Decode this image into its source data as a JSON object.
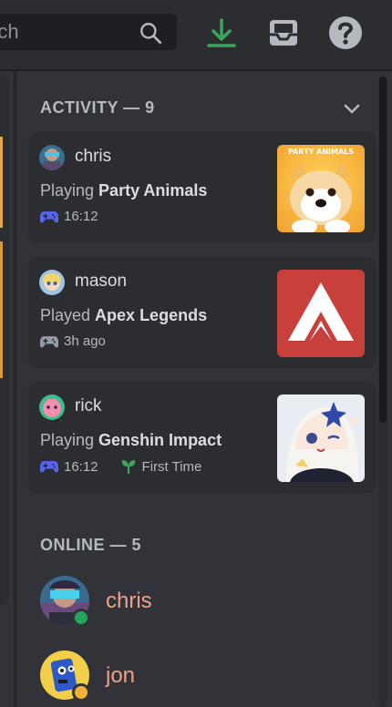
{
  "search": {
    "placeholder": "rch"
  },
  "toolbar": {
    "download_icon": "download-icon",
    "inbox_icon": "inbox-icon",
    "help_icon": "help-icon"
  },
  "colors": {
    "background": "#313338",
    "card": "#2b2d31",
    "download_green": "#3ba55c",
    "online_green": "#23a55a",
    "member_name": "#f0a18a",
    "gamepad_blue": "#5865f2"
  },
  "activity": {
    "header": "ACTIVITY — 9",
    "cards": [
      {
        "username": "chris",
        "verb": "Playing ",
        "game": "Party Animals",
        "time": "16:12",
        "thumb_text": "PARTY ANIMALS"
      },
      {
        "username": "mason",
        "verb": "Played ",
        "game": "Apex Legends",
        "time": "3h ago"
      },
      {
        "username": "rick",
        "verb": "Playing ",
        "game": "Genshin Impact",
        "time": "16:12",
        "badge": "First Time"
      }
    ]
  },
  "online": {
    "header": "ONLINE — 5",
    "members": [
      {
        "name": "chris",
        "status": "online"
      },
      {
        "name": "jon",
        "status": "idle"
      }
    ]
  }
}
